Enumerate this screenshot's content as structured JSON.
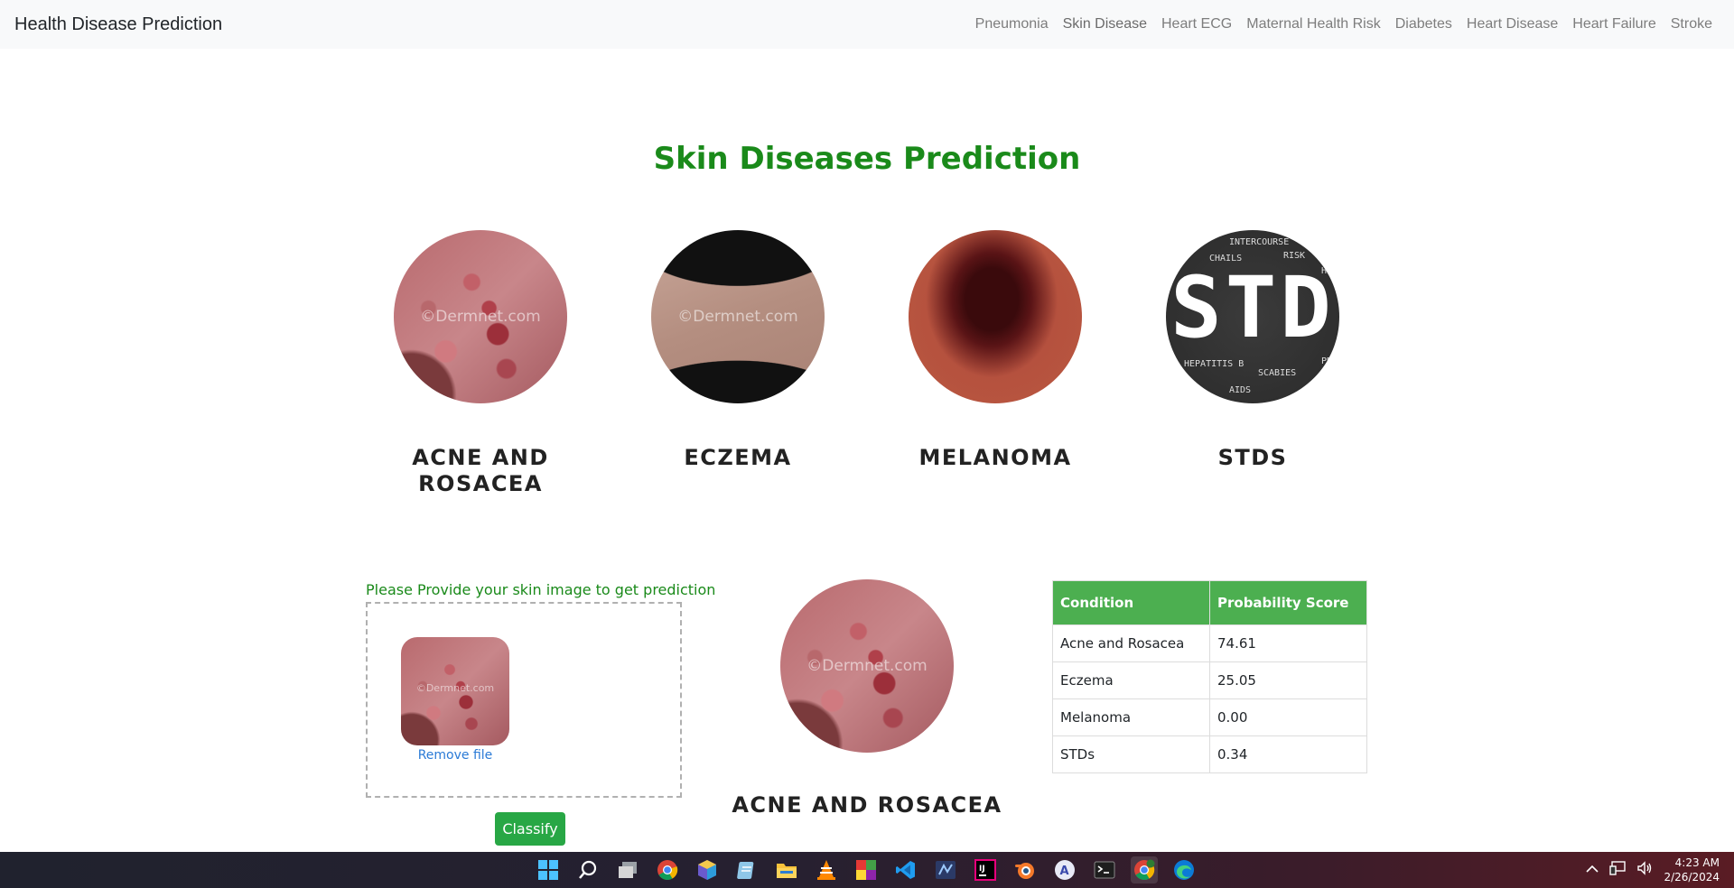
{
  "navbar": {
    "brand": "Health Disease Prediction",
    "links": [
      "Pneumonia",
      "Skin Disease",
      "Heart ECG",
      "Maternal Health Risk",
      "Diabetes",
      "Heart Disease",
      "Heart Failure",
      "Stroke"
    ]
  },
  "page_title": "Skin Diseases Prediction",
  "cards": [
    {
      "label": "ACNE AND ROSACEA",
      "watermark": "©Dermnet.com"
    },
    {
      "label": "ECZEMA",
      "watermark": "©Dermnet.com"
    },
    {
      "label": "MELANOMA"
    },
    {
      "label": "STDS",
      "image_text": "STD",
      "image_words": [
        "INTERCOURSE",
        "CHAILS",
        "RISK",
        "HEPATITIS B",
        "SCABIES",
        "AIDS",
        "HE",
        "PR"
      ]
    }
  ],
  "upload": {
    "prompt": "Please Provide your skin image to get prediction",
    "thumb_watermark": "©Dermnet.com",
    "remove_label": "Remove file",
    "classify_label": "Classify"
  },
  "result": {
    "label": "ACNE AND ROSACEA",
    "watermark": "©Dermnet.com"
  },
  "table": {
    "headers": [
      "Condition",
      "Probability Score"
    ],
    "rows": [
      [
        "Acne and Rosacea",
        "74.61"
      ],
      [
        "Eczema",
        "25.05"
      ],
      [
        "Melanoma",
        "0.00"
      ],
      [
        "STDs",
        "0.34"
      ]
    ]
  },
  "taskbar": {
    "icons": [
      "windows-start-icon",
      "search-icon",
      "task-view-icon",
      "chrome-icon",
      "cube-app-icon",
      "notepad-icon",
      "file-explorer-icon",
      "vlc-icon",
      "colorful-grid-app-icon",
      "vscode-icon",
      "ssms-icon",
      "jetbrains-icon",
      "blender-icon",
      "browser-a-icon",
      "terminal-icon",
      "chrome-profile-icon",
      "edge-icon"
    ],
    "time": "4:23 AM",
    "date": "2/26/2024"
  },
  "colors": {
    "accent_green": "#28a745",
    "title_green": "#1a8a1a",
    "header_green": "#4caf50"
  }
}
